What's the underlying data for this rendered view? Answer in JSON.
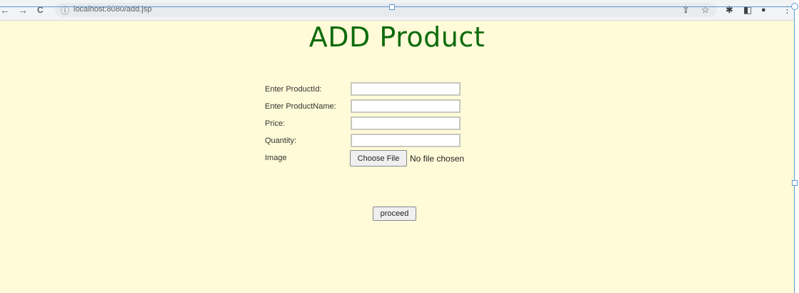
{
  "browser": {
    "back_icon": "←",
    "forward_icon": "→",
    "reload_icon": "C",
    "info_icon": "ⓘ",
    "url": "localhost:8080/add.jsp",
    "share_icon": "⇪",
    "star_icon": "☆",
    "extensions_icon": "✱",
    "sidepanel_icon": "◧",
    "profile_icon": "●",
    "menu_icon": "⋮"
  },
  "page": {
    "title": "ADD Product",
    "fields": [
      {
        "label": "Enter ProductId:",
        "value": ""
      },
      {
        "label": "Enter ProductName:",
        "value": ""
      },
      {
        "label": "Price:",
        "value": ""
      },
      {
        "label": "Quantity:",
        "value": ""
      }
    ],
    "image": {
      "label": "Image",
      "button": "Choose File",
      "status": "No file chosen"
    },
    "submit_label": "proceed"
  },
  "colors": {
    "page_background": "#fffad7",
    "title_color": "#0d6b0d"
  }
}
